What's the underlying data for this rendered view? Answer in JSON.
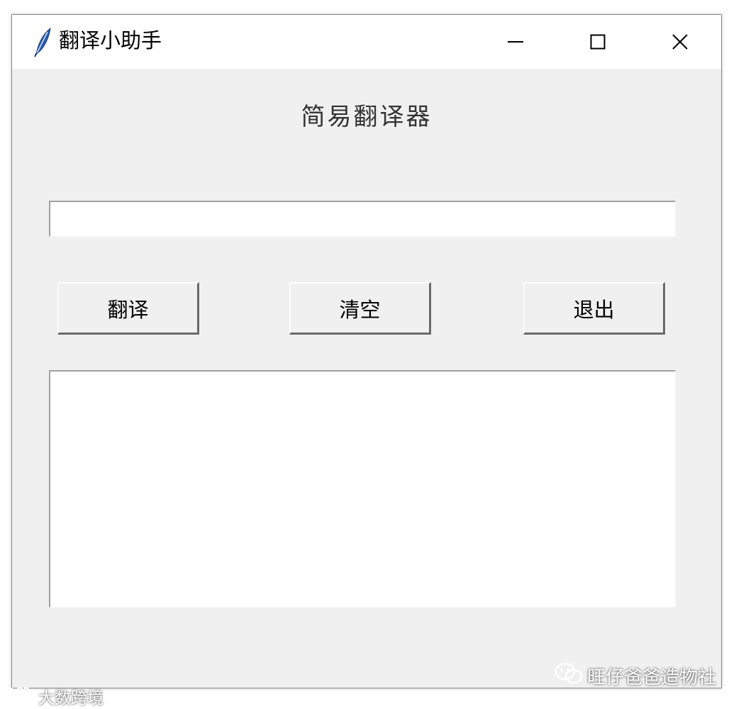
{
  "window": {
    "title": "翻译小助手",
    "app_icon": "feather-icon",
    "controls": {
      "minimize_icon": "minimize-icon",
      "maximize_icon": "maximize-icon",
      "close_icon": "close-icon"
    }
  },
  "main": {
    "heading": "简易翻译器",
    "input": {
      "value": "",
      "placeholder": ""
    },
    "buttons": {
      "translate": "翻译",
      "clear": "清空",
      "exit": "退出"
    },
    "output": {
      "value": ""
    }
  },
  "watermarks": {
    "bottom_right": "旺仔爸爸造物社",
    "bottom_left": "大数跨境"
  },
  "colors": {
    "window_bg": "#f0f0f0",
    "titlebar_bg": "#ffffff",
    "field_bg": "#ffffff"
  }
}
